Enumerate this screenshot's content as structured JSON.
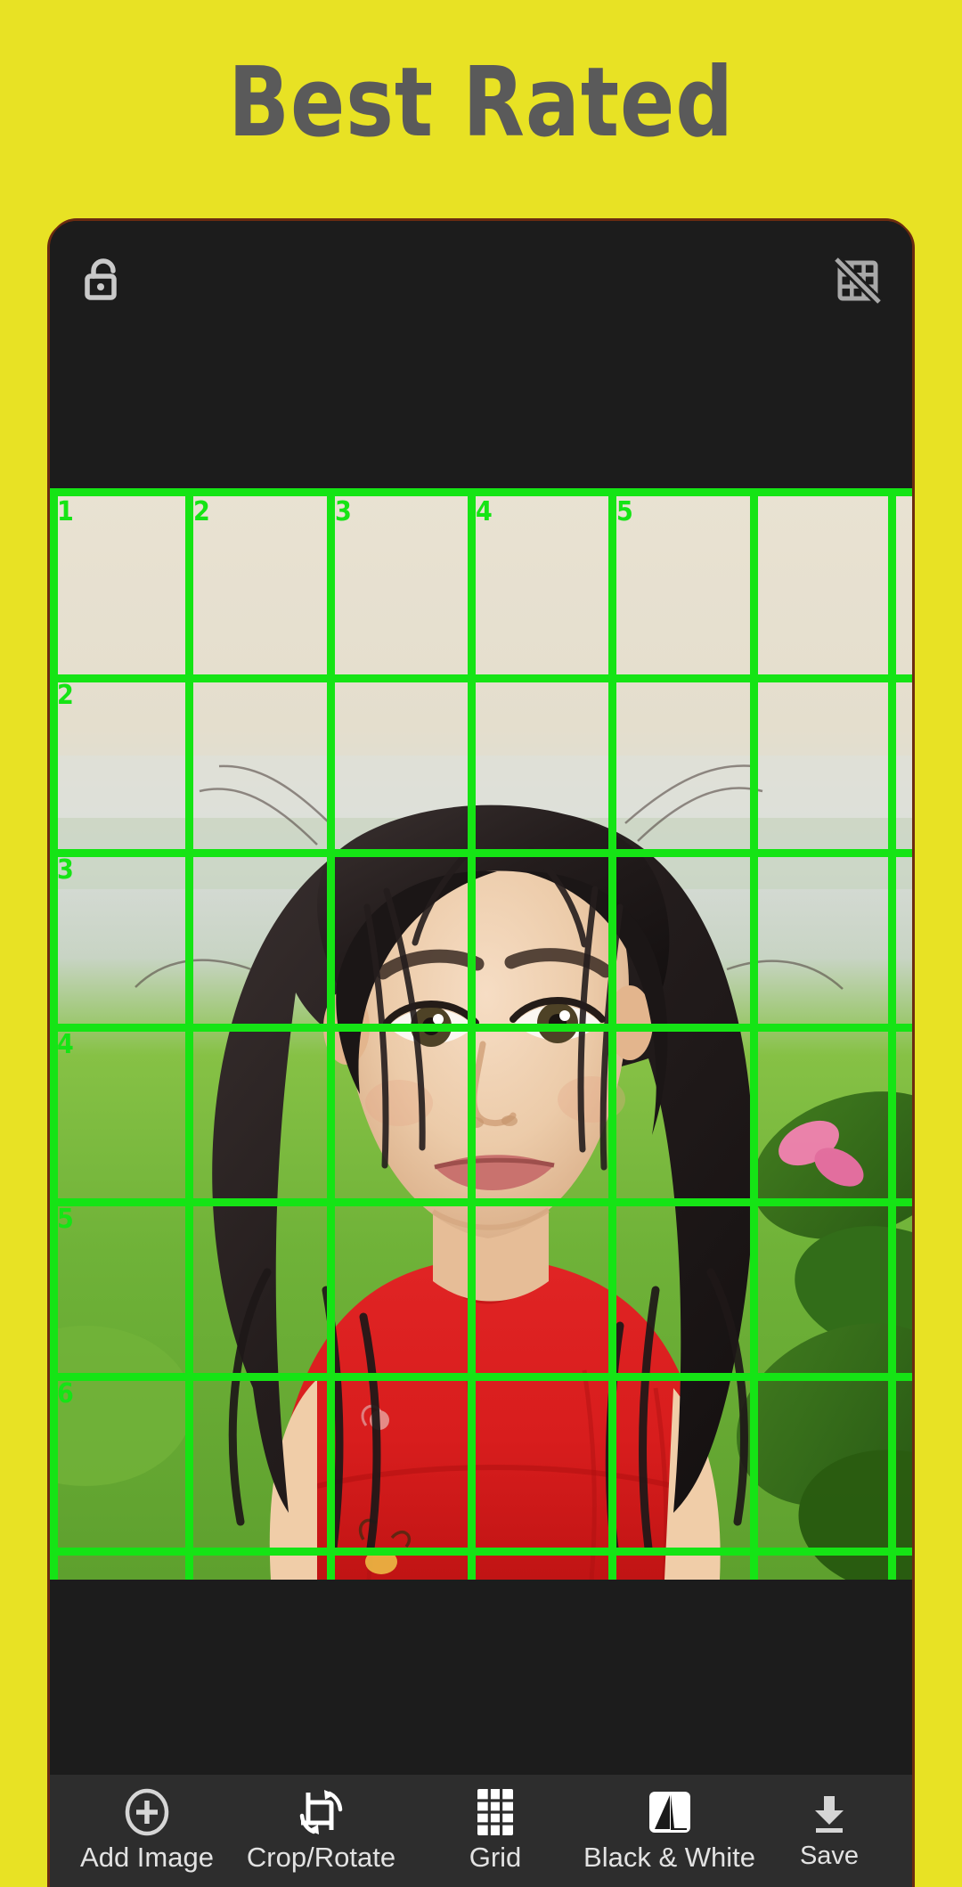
{
  "headline": "Best Rated",
  "theme": {
    "background": "#e8e224",
    "headline_color": "#5a5a5a",
    "frame_color": "#1c1c1c",
    "toolbar_color": "#2d2d2d",
    "grid_color": "#15e415",
    "icon_color": "#c9c9c9",
    "frame_edge": "#6b2b10"
  },
  "appbar": {
    "lock_icon": "unlock-icon",
    "grid_off_icon": "grid-off-icon"
  },
  "editor": {
    "grid": {
      "columns": 5,
      "rows": 6,
      "column_labels": [
        "1",
        "2",
        "3",
        "4",
        "5"
      ],
      "row_labels": [
        "1",
        "2",
        "3",
        "4",
        "5",
        "6"
      ]
    },
    "photo_subject": "young girl in red shirt outdoors"
  },
  "toolbar": {
    "items": [
      {
        "label": "Add Image",
        "icon": "plus-circle-icon"
      },
      {
        "label": "Crop/Rotate",
        "icon": "crop-rotate-icon"
      },
      {
        "label": "Grid",
        "icon": "grid-icon"
      },
      {
        "label": "Black & White",
        "icon": "black-white-icon"
      },
      {
        "label": "Save",
        "icon": "download-icon"
      }
    ]
  }
}
